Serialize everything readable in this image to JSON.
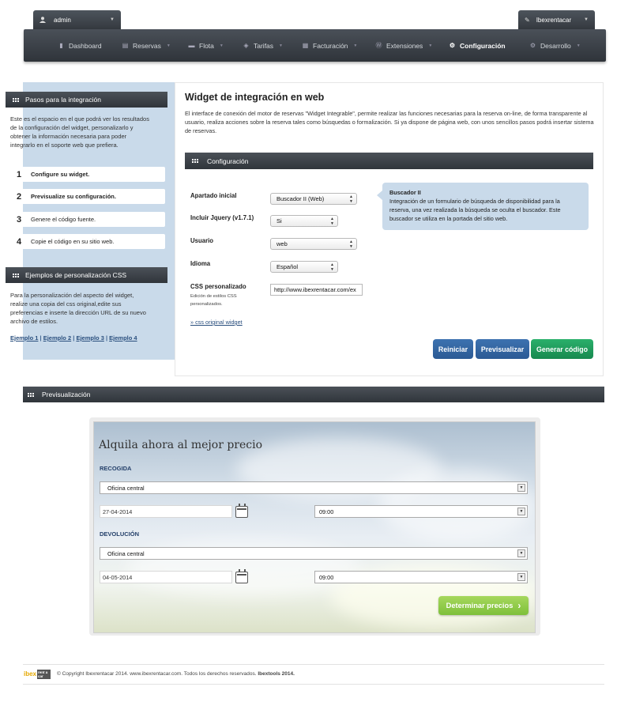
{
  "topbar": {
    "user_label": "admin",
    "company_label": "Ibexrentacar"
  },
  "nav": {
    "items": [
      {
        "label": "Dashboard",
        "icon": "dashboard-icon"
      },
      {
        "label": "Reservas",
        "icon": "calendar-icon"
      },
      {
        "label": "Flota",
        "icon": "car-icon"
      },
      {
        "label": "Tarifas",
        "icon": "tag-icon"
      },
      {
        "label": "Facturación",
        "icon": "invoice-icon"
      },
      {
        "label": "Extensiones",
        "icon": "wordpress-icon"
      },
      {
        "label": "Configuración",
        "icon": "gears-icon",
        "active": true
      },
      {
        "label": "Desarrollo",
        "icon": "cogs-icon"
      }
    ]
  },
  "sidebar": {
    "steps_title": "Pasos para la integración",
    "steps_intro": "Este es el espacio en el que podrá ver los resultados de la configuración del widget, personalizarlo y obtener la información necesaria para poder integrarlo en el soporte web que prefiera.",
    "steps": [
      {
        "num": "1",
        "text": "Configure su widget."
      },
      {
        "num": "2",
        "text": "Previsualize su configuración."
      },
      {
        "num": "3",
        "text": "Genere el código fuente."
      },
      {
        "num": "4",
        "text": "Copie el código en su sitio web."
      }
    ],
    "css_title": "Ejemplos de personalización CSS",
    "css_intro": "Para la personalización del aspecto del widget, realize una copia del css original,edite sus preferencias e inserte la dirección URL de su nuevo archivo de estilos.",
    "examples": [
      "Ejemplo 1",
      "Ejemplo 2",
      "Ejemplo 3",
      "Ejemplo 4"
    ]
  },
  "main": {
    "title": "Widget de integración en web",
    "description": "El interface de conexión del motor de reservas \"Widget Integrable\", permite realizar las funciones necesarias para la reserva on-line, de forma transparente al usuario, realiza acciones sobre la reserva tales como búsquedas o formalización. Si ya dispone de página web, con unos sencillos pasos podrá insertar sistema de reservas.",
    "config_title": "Configuración",
    "fields": {
      "apartado_label": "Apartado inicial",
      "apartado_value": "Buscador II (Web)",
      "jquery_label": "Incluir Jquery (v1.7.1)",
      "jquery_value": "Si",
      "usuario_label": "Usuario",
      "usuario_value": "web",
      "idioma_label": "Idioma",
      "idioma_value": "Español",
      "css_label": "CSS personalizado",
      "css_sub": "Edición de estilos CSS personalizados.",
      "css_value": "http://www.ibexrentacar.com/ex",
      "css_link": "» css original widget"
    },
    "tip": {
      "title": "Buscador II",
      "text": "Integración de un formulario de búsqueda de disponibilidad para la reserva, una vez realizada la búsqueda se oculta el buscador. Este buscador se utiliza en la portada del sitio web."
    },
    "buttons": {
      "reset": "Reiniciar",
      "preview": "Previsualizar",
      "generate": "Generar código"
    },
    "colors": {
      "reset": "#2f5f99",
      "preview": "#2f5f99",
      "generate": "#1f9a5c"
    }
  },
  "preview": {
    "title": "Previsualización",
    "widget": {
      "heading": "Alquila ahora al mejor precio",
      "pickup_label": "RECOGIDA",
      "pickup_office": "Oficina central",
      "pickup_date": "27-04-2014",
      "pickup_time": "09:00",
      "return_label": "DEVOLUCIÓN",
      "return_office": "Oficina central",
      "return_date": "04-05-2014",
      "return_time": "09:00",
      "submit": "Determinar precios",
      "submit_arrow": "›"
    }
  },
  "footer": {
    "logo_text": "ibex",
    "logo_sub": "rent a car",
    "copyright": "© Copyright Ibexrentacar 2014. www.ibexrentacar.com. Todos los derechos reservados.",
    "brand": "Ibextools 2014."
  }
}
